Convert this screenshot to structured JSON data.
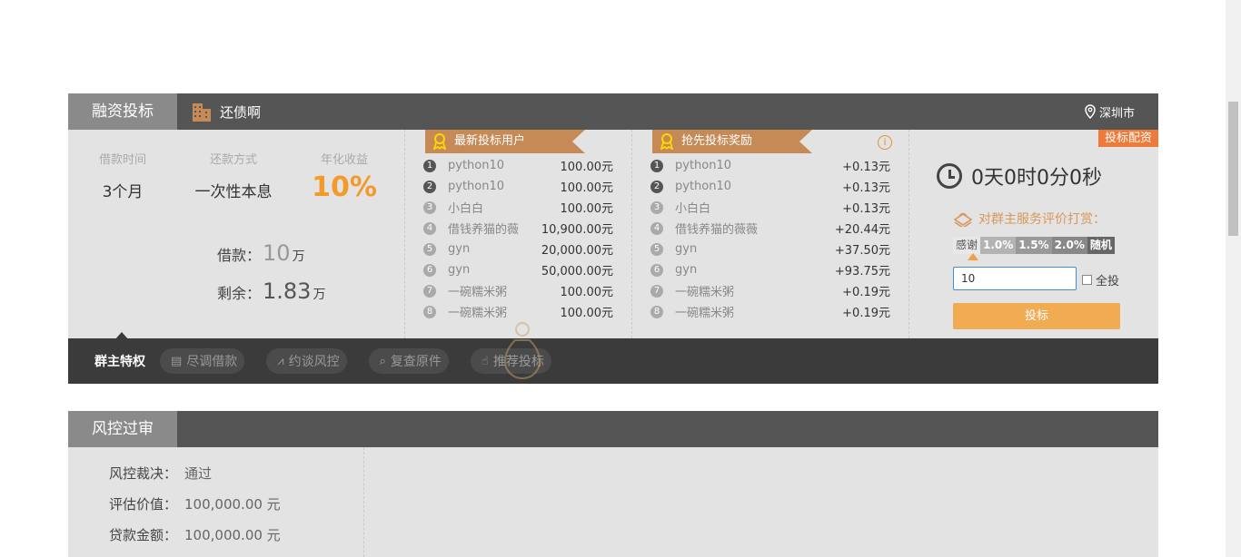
{
  "financing": {
    "tab_title": "融资投标",
    "project_name": "还债啊",
    "city": "深圳市",
    "loan_term_label": "借款时间",
    "loan_term_value": "3个月",
    "repay_label": "还款方式",
    "repay_value": "一次性本息",
    "rate_label": "年化收益",
    "rate_value": "10%",
    "borrow_label": "借款：",
    "borrow_value": "10",
    "borrow_unit": "万",
    "remain_label": "剩余：",
    "remain_value": "1.83",
    "remain_unit": "万"
  },
  "latest_bidders": {
    "title": "最新投标用户",
    "rows": [
      {
        "rank": "1",
        "name": "python10",
        "amount": "100.00元"
      },
      {
        "rank": "2",
        "name": "python10",
        "amount": "100.00元"
      },
      {
        "rank": "3",
        "name": "小白白",
        "amount": "100.00元"
      },
      {
        "rank": "4",
        "name": "借钱养猫的薇",
        "amount": "10,900.00元"
      },
      {
        "rank": "5",
        "name": "gyn",
        "amount": "20,000.00元"
      },
      {
        "rank": "6",
        "name": "gyn",
        "amount": "50,000.00元"
      },
      {
        "rank": "7",
        "name": "一碗糯米粥",
        "amount": "100.00元"
      },
      {
        "rank": "8",
        "name": "一碗糯米粥",
        "amount": "100.00元"
      }
    ]
  },
  "rewards": {
    "title": "抢先投标奖励",
    "info_icon": "i",
    "rows": [
      {
        "rank": "1",
        "name": "python10",
        "amount": "+0.13元"
      },
      {
        "rank": "2",
        "name": "python10",
        "amount": "+0.13元"
      },
      {
        "rank": "3",
        "name": "小白白",
        "amount": "+0.13元"
      },
      {
        "rank": "4",
        "name": "借钱养猫的薇薇",
        "amount": "+20.44元"
      },
      {
        "rank": "5",
        "name": "gyn",
        "amount": "+37.50元"
      },
      {
        "rank": "6",
        "name": "gyn",
        "amount": "+93.75元"
      },
      {
        "rank": "7",
        "name": "一碗糯米粥",
        "amount": "+0.19元"
      },
      {
        "rank": "8",
        "name": "一碗糯米粥",
        "amount": "+0.19元"
      }
    ]
  },
  "bid": {
    "badge": "投标配资",
    "countdown": "0天0时0分0秒",
    "tip_prompt": "对群主服务评价打赏：",
    "tip_options": [
      "感谢",
      "1.0%",
      "1.5%",
      "2.0%",
      "随机"
    ],
    "amount_value": "10",
    "all_in_label": "全投",
    "submit_label": "投标"
  },
  "tabs": {
    "active": "群主特权",
    "items": [
      "尽调借款",
      "约谈风控",
      "复查原件",
      "推荐投标"
    ]
  },
  "risk": {
    "tab_title": "风控过审",
    "rows": [
      {
        "k": "风控裁决：",
        "v": "通过"
      },
      {
        "k": "评估价值：",
        "v": "100,000.00 元"
      },
      {
        "k": "贷款金额：",
        "v": "100,000.00 元"
      }
    ]
  },
  "colors": {
    "accent_orange": "#f39a2b",
    "ribbon_brown": "#c68a56",
    "header_dark": "#555555",
    "button_orange": "#f1ab52"
  }
}
